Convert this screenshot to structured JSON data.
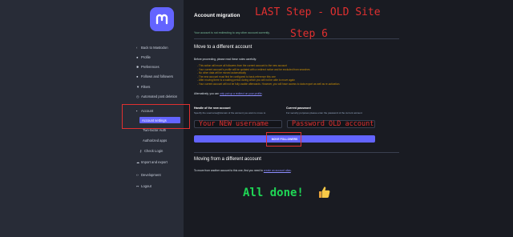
{
  "sidebar": {
    "items": [
      {
        "icon": "chevron-left-icon",
        "glyph": "‹",
        "label": "Back to Mastodon"
      },
      {
        "icon": "user-icon",
        "glyph": "●",
        "label": "Profile"
      },
      {
        "icon": "gear-icon",
        "glyph": "✱",
        "label": "Preferences"
      },
      {
        "icon": "users-icon",
        "glyph": "●",
        "label": "Follows and followers"
      },
      {
        "icon": "filter-icon",
        "glyph": "▼",
        "label": "Filters"
      },
      {
        "icon": "history-icon",
        "glyph": "◷",
        "label": "Automated post deletion"
      },
      {
        "icon": "lock-icon",
        "glyph": "▪",
        "label": "Account"
      },
      {
        "icon": "",
        "glyph": "",
        "label": "Account settings"
      },
      {
        "icon": "",
        "glyph": "",
        "label": "Two-factor Auth"
      },
      {
        "icon": "",
        "glyph": "",
        "label": "Authorized apps"
      },
      {
        "icon": "key-icon",
        "glyph": "⚷",
        "label": "Check Login"
      },
      {
        "icon": "cloud-icon",
        "glyph": "☁",
        "label": "Import and export"
      },
      {
        "icon": "code-icon",
        "glyph": "‹›",
        "label": "Development"
      },
      {
        "icon": "logout-icon",
        "glyph": "↦",
        "label": "Logout"
      }
    ]
  },
  "main": {
    "title": "Account migration",
    "notice": "Your account is not redirecting to any other account currently.",
    "move_heading": "Move to a different account",
    "before_text": "Before proceeding, please read these notes carefully:",
    "warnings": [
      "- This action will move all followers from the current account to the new account",
      "- Your current account's profile will be updated with a redirect notice and be excluded from searches",
      "- No other data will be moved automatically",
      "- The new account must first be configured to back-reference this one",
      "- After moving there is a waiting period during which you will not be able to move again",
      "- Your current account will not be fully usable afterwards. However, you will have access to data export as well as re-activation."
    ],
    "alt_prefix": "Alternatively, you can ",
    "alt_link": "only put up a redirect on your profile",
    "alt_suffix": ".",
    "handle_label": "Handle of the new account",
    "handle_hint": "Specify the username@domain of the account you want to move to",
    "password_label": "Current password",
    "password_hint": "For security purposes please enter the password of the current account",
    "handle_value": "Your NEW username",
    "password_value": "Password OLD account",
    "move_button": "MOVE FOLLOWERS",
    "moving_heading": "Moving from a different account",
    "moving_prefix": "To move from another account to this one, first you need to ",
    "moving_link": "create an account alias",
    "moving_suffix": "."
  },
  "annotations": {
    "step_title": "LAST Step - OLD Site",
    "step_number": "Step 6",
    "done": "All done!",
    "done_emoji": "thumbs-up-icon"
  },
  "colors": {
    "accent": "#6364ff",
    "annotation_red": "#e03030",
    "done_green": "#1fd655",
    "warning": "#ca8f04",
    "success": "#79bd9a"
  }
}
